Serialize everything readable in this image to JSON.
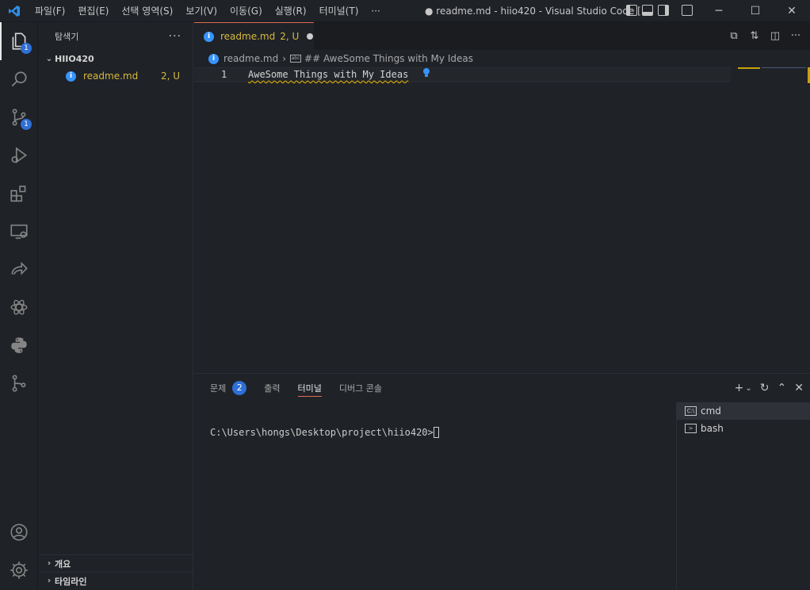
{
  "titlebar": {
    "menu": [
      "파일(F)",
      "편집(E)",
      "선택 영역(S)",
      "보기(V)",
      "이동(G)",
      "실행(R)",
      "터미널(T)",
      "···"
    ],
    "window_title": "● readme.md - hiio420 - Visual Studio Code [..."
  },
  "activity": {
    "explorer_badge": "1",
    "scm_badge": "1"
  },
  "sidebar": {
    "title": "탐색기",
    "more": "···",
    "folder": "HIIO420",
    "file": {
      "name": "readme.md",
      "status": "2, U"
    },
    "outline": "개요",
    "timeline": "타임라인"
  },
  "editor": {
    "tab": {
      "name": "readme.md",
      "status": "2, U"
    },
    "breadcrumb": {
      "file": "readme.md",
      "symbol": "## AweSome Things with My Ideas"
    },
    "line_number": "1",
    "line_text": "AweSome Things with My Ideas"
  },
  "panel": {
    "tabs": [
      {
        "label": "문제",
        "badge": "2"
      },
      {
        "label": "출력"
      },
      {
        "label": "터미널"
      },
      {
        "label": "디버그 콘솔"
      }
    ],
    "terminal_prompt": "C:\\Users\\hongs\\Desktop\\project\\hiio420>",
    "terminals": [
      "cmd",
      "bash"
    ]
  },
  "colors": {
    "accent": "#2f6fd6",
    "modified": "#d7ba3d",
    "tab_border": "#e06c55",
    "background": "#1f2227"
  }
}
